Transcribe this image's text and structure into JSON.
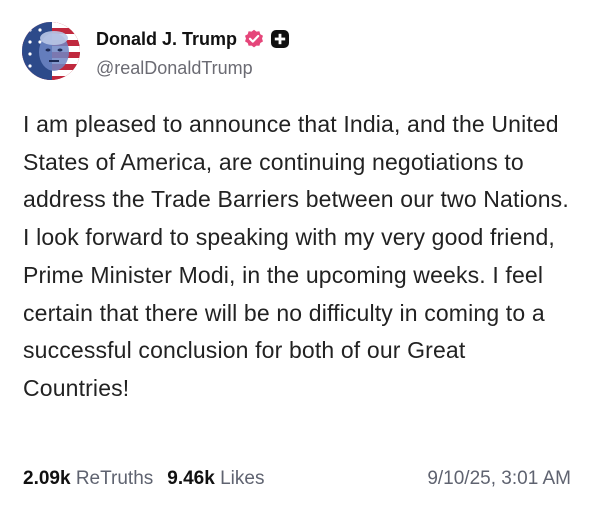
{
  "author": {
    "display_name": "Donald J. Trump",
    "handle": "@realDonaldTrump",
    "verified_icon": "verified-badge-icon",
    "plus_icon": "plus-badge-icon",
    "verified_color": "#e5467a"
  },
  "post": {
    "text": "I am pleased to announce that India, and the United States of America, are continuing negotiations to address the Trade Barriers between our two Nations. I look forward to speaking with my very good friend, Prime Minister Modi, in the upcoming weeks. I feel certain that there will be no difficulty in coming to a successful conclusion for both of our Great Countries!"
  },
  "stats": {
    "retruths_count": "2.09k",
    "retruths_label": "ReTruths",
    "likes_count": "9.46k",
    "likes_label": "Likes"
  },
  "timestamp": "9/10/25, 3:01 AM"
}
